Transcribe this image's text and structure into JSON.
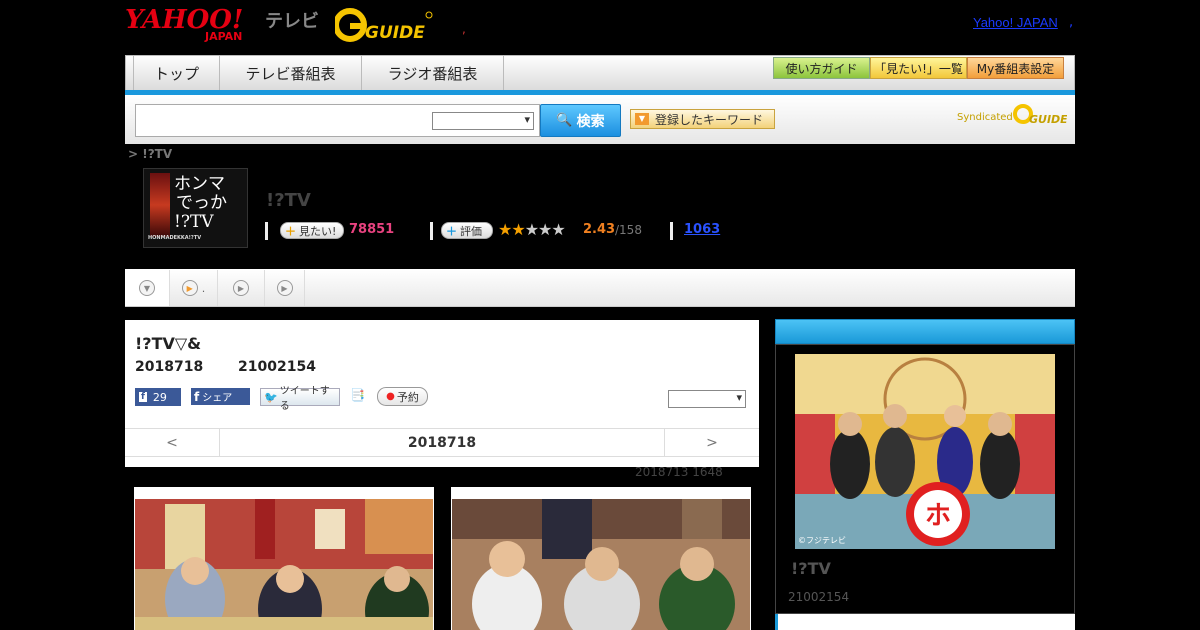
{
  "header": {
    "logo_yahoo": "YAHOO!",
    "logo_japan": "JAPAN",
    "logo_tv": "テレビ",
    "logo_gguide": "GUIDE",
    "separator": ",",
    "yahoo_link": "Yahoo! JAPAN",
    "yahoo_link_tail": ","
  },
  "nav": {
    "tabs": [
      "トップ",
      "テレビ番組表",
      "ラジオ番組表"
    ],
    "buttons": [
      "使い方ガイド",
      "「見たい!」一覧",
      "My番組表設定"
    ]
  },
  "search": {
    "value": "",
    "select_value": "",
    "button_label": "検索",
    "keyword_button": "登録したキーワード",
    "syndicated": "Syndicated",
    "syndicated_logo": "GUIDE"
  },
  "breadcrumb": "> !?TV",
  "program": {
    "thumb_text": [
      "ホンマ",
      "でっか",
      "!?TV"
    ],
    "thumb_small": "HONMADEKKA!?TV",
    "title": "!?TV",
    "mitai_label": "見たい!",
    "mitai_count": "78851",
    "rating_label": "評価",
    "rating_stars": 2.43,
    "rating_score": "2.43",
    "rating_total": "/158",
    "review_count": "1063"
  },
  "tabs": {
    "second_label": "."
  },
  "article": {
    "title": "!?TV▽&",
    "date": "2018718",
    "id": "21002154",
    "fb_count": "29",
    "fb_share": "シェア",
    "tweet": "ツイートする",
    "reserve": "予約",
    "select_value": "",
    "pager_prev": "<",
    "pager_date": "2018718",
    "pager_next": ">",
    "post_time": "2018713  1648"
  },
  "sidebar": {
    "header": "",
    "photo_credit": "©フジテレビ",
    "title": "!?TV",
    "id": "21002154"
  },
  "colors": {
    "accent_blue": "#1a98dd",
    "mitai_pink": "#e8427f",
    "rating_orange": "#f08020",
    "link_blue": "#2a52ff"
  }
}
